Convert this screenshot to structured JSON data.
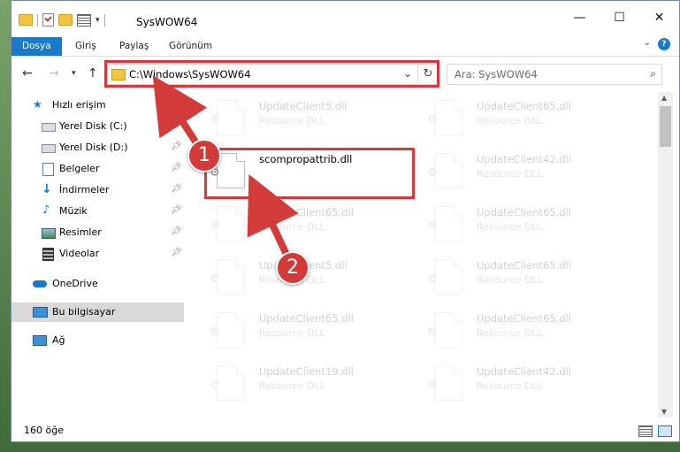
{
  "window": {
    "title": "SysWOW64"
  },
  "ribbon": {
    "tabs": [
      {
        "label": "Dosya",
        "active": true
      },
      {
        "label": "Giriş",
        "active": false
      },
      {
        "label": "Paylaş",
        "active": false
      },
      {
        "label": "Görünüm",
        "active": false
      }
    ]
  },
  "address": {
    "path": "C:\\Windows\\SysWOW64"
  },
  "search": {
    "placeholder": "Ara: SysWOW64"
  },
  "sidebar": {
    "items": [
      {
        "label": "Hızlı erişim",
        "icon": "star-icon"
      },
      {
        "label": "Yerel Disk (C:)",
        "icon": "drive-icon",
        "pinned": true
      },
      {
        "label": "Yerel Disk (D:)",
        "icon": "drive-icon",
        "pinned": true
      },
      {
        "label": "Belgeler",
        "icon": "documents-icon",
        "pinned": true
      },
      {
        "label": "İndirmeler",
        "icon": "download-icon",
        "pinned": true
      },
      {
        "label": "Müzik",
        "icon": "music-icon",
        "pinned": true
      },
      {
        "label": "Resimler",
        "icon": "pictures-icon",
        "pinned": true
      },
      {
        "label": "Videolar",
        "icon": "video-icon",
        "pinned": true
      },
      {
        "label": "OneDrive",
        "icon": "onedrive-icon"
      },
      {
        "label": "Bu bilgisayar",
        "icon": "computer-icon",
        "selected": true
      },
      {
        "label": "Ağ",
        "icon": "network-icon"
      }
    ]
  },
  "files": {
    "left": [
      {
        "name": "UpdateClient5.dll",
        "type": "Resource DLL"
      },
      {
        "name": "scompropattrib.dll",
        "type": ""
      },
      {
        "name": "UpdateClient65.dll",
        "type": "Resource DLL"
      },
      {
        "name": "UpdateClient5.dll",
        "type": "Resource DLL"
      },
      {
        "name": "UpdateClient65.dll",
        "type": "Resource DLL"
      },
      {
        "name": "UpdateClient19.dll",
        "type": "Resource DLL"
      }
    ],
    "right": [
      {
        "name": "UpdateClient65.dll",
        "type": "Resource DLL"
      },
      {
        "name": "UpdateClient42.dll",
        "type": "Resource DLL"
      },
      {
        "name": "UpdateClient65.dll",
        "type": "Resource DLL"
      },
      {
        "name": "UpdateClient65.dll",
        "type": "Resource DLL"
      },
      {
        "name": "UpdateClient65.dll",
        "type": "Resource DLL"
      },
      {
        "name": "UpdateClient42.dll",
        "type": "Resource DLL"
      }
    ]
  },
  "status": {
    "count": "160 öğe"
  },
  "annotations": {
    "step1": "1",
    "step2": "2"
  },
  "colors": {
    "accent": "#1979ca",
    "annotation": "#d33b3b"
  }
}
